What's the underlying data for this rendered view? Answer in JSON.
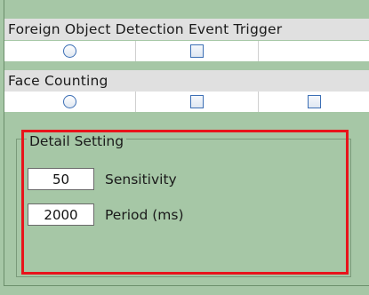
{
  "sections": [
    {
      "title": "Foreign Object Detection Event Trigger",
      "controls": [
        "radio",
        "checkbox",
        "empty"
      ]
    },
    {
      "title": "Face Counting",
      "controls": [
        "radio",
        "checkbox",
        "checkbox"
      ]
    }
  ],
  "detail": {
    "legend": "Detail Setting",
    "sensitivity": {
      "value": "50",
      "label": "Sensitivity"
    },
    "period": {
      "value": "2000",
      "label": "Period (ms)"
    }
  },
  "colors": {
    "panel_bg": "#a6c7a6",
    "header_bg": "#e0e0e0",
    "highlight": "#e8141b"
  }
}
